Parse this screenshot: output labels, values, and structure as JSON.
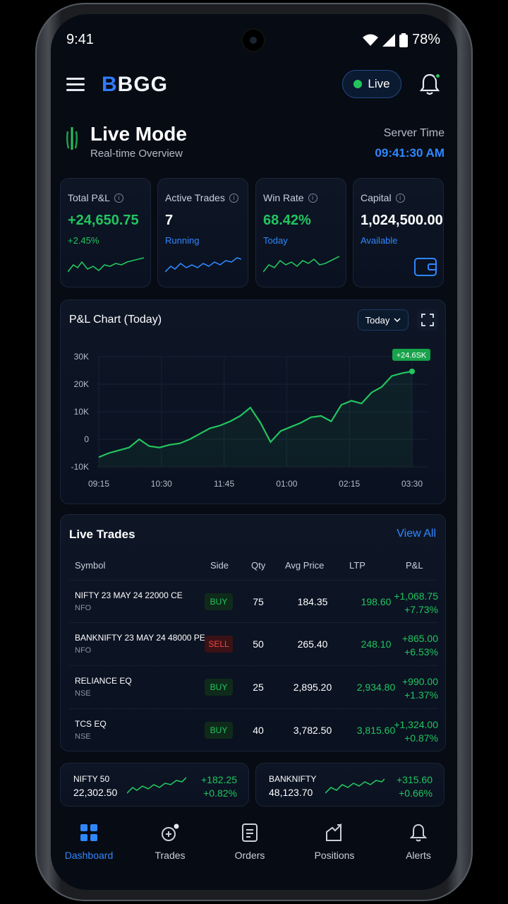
{
  "status": {
    "time": "9:41",
    "battery": "78%"
  },
  "header": {
    "logo_prefix": "B",
    "logo_rest": "BGG",
    "live_label": "Live"
  },
  "mode": {
    "title": "Live Mode",
    "subtitle": "Real-time Overview",
    "server_label": "Server Time",
    "server_time": "09:41:30 AM"
  },
  "stats": [
    {
      "label": "Total P&L",
      "value": "+24,650.75",
      "sub": "+2.45%"
    },
    {
      "label": "Active Trades",
      "value": "7",
      "sub": "Running"
    },
    {
      "label": "Win Rate",
      "value": "68.42%",
      "sub": "Today"
    },
    {
      "label": "Capital",
      "value": "1,024,500.00",
      "sub": "Available"
    }
  ],
  "chart": {
    "title": "P&L Chart (Today)",
    "range_button": "Today",
    "badge": "+24.6SK"
  },
  "chart_data": {
    "type": "line",
    "title": "P&L Chart (Today)",
    "x_ticks": [
      "09:15",
      "10:30",
      "11:45",
      "01:00",
      "02:15",
      "03:30"
    ],
    "y_ticks": [
      "30K",
      "20K",
      "10K",
      "0",
      "-10K"
    ],
    "ylim": [
      -10000,
      30000
    ],
    "series": [
      {
        "values": [
          -6500,
          -5000,
          -4000,
          -3000,
          0,
          -2500,
          -3000,
          -2000,
          -1500,
          0,
          2000,
          4000,
          5000,
          6500,
          8500,
          11500,
          6000,
          -1000,
          3000,
          4500,
          6000,
          8000,
          8500,
          6500,
          12500,
          14000,
          13000,
          17000,
          19000,
          23000,
          24000,
          24650
        ]
      }
    ],
    "grid": true
  },
  "trades": {
    "title": "Live Trades",
    "view_all": "View All",
    "columns": [
      "Symbol",
      "Side",
      "Qty",
      "Avg Price",
      "LTP",
      "P&L"
    ],
    "rows": [
      {
        "symbol": "NIFTY 23 MAY 24 22000 CE",
        "exchange": "NFO",
        "side": "BUY",
        "qty": "75",
        "avg": "184.35",
        "ltp": "198.60",
        "pnl": "+1,068.75",
        "pnl_pct": "+7.73%"
      },
      {
        "symbol": "BANKNIFTY 23 MAY 24 48000 PE",
        "exchange": "NFO",
        "side": "SELL",
        "qty": "50",
        "avg": "265.40",
        "ltp": "248.10",
        "pnl": "+865.00",
        "pnl_pct": "+6.53%"
      },
      {
        "symbol": "RELIANCE EQ",
        "exchange": "NSE",
        "side": "BUY",
        "qty": "25",
        "avg": "2,895.20",
        "ltp": "2,934.80",
        "pnl": "+990.00",
        "pnl_pct": "+1.37%"
      },
      {
        "symbol": "TCS EQ",
        "exchange": "NSE",
        "side": "BUY",
        "qty": "40",
        "avg": "3,782.50",
        "ltp": "3,815.60",
        "pnl": "+1,324.00",
        "pnl_pct": "+0.87%"
      }
    ]
  },
  "indices": [
    {
      "name": "NIFTY 50",
      "price": "22,302.50",
      "change": "+182.25",
      "change_pct": "+0.82%"
    },
    {
      "name": "BANKNIFTY",
      "price": "48,123.70",
      "change": "+315.60",
      "change_pct": "+0.66%"
    }
  ],
  "nav": [
    {
      "label": "Dashboard",
      "icon": "dashboard-icon"
    },
    {
      "label": "Trades",
      "icon": "trades-icon"
    },
    {
      "label": "Orders",
      "icon": "orders-icon"
    },
    {
      "label": "Positions",
      "icon": "positions-icon"
    },
    {
      "label": "Alerts",
      "icon": "alerts-icon"
    }
  ],
  "colors": {
    "accent": "#2f87ff",
    "profit": "#22c55e",
    "loss": "#ef4444",
    "background": "#070b14"
  }
}
